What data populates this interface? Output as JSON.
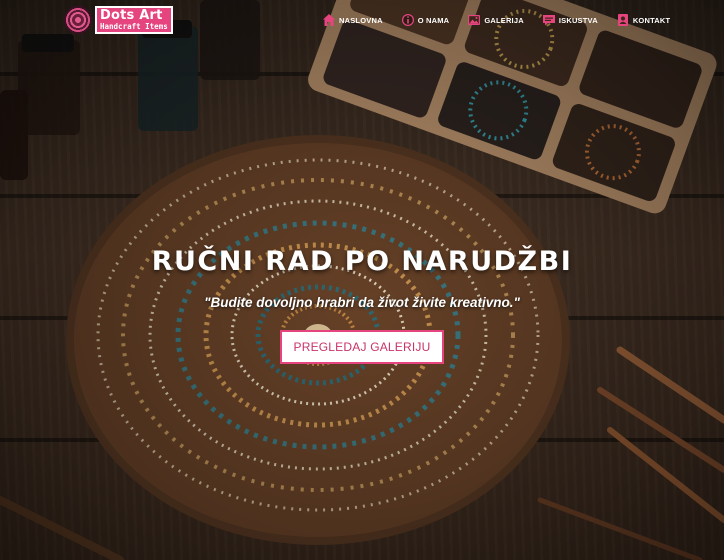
{
  "brand": {
    "name": "Dots Art",
    "tagline": "Handcraft Items",
    "accent": "#e6447e"
  },
  "nav": {
    "items": [
      {
        "label": "NASLOVNA",
        "icon": "home-icon"
      },
      {
        "label": "O NAMA",
        "icon": "info-icon"
      },
      {
        "label": "GALERIJA",
        "icon": "gallery-icon"
      },
      {
        "label": "ISKUSTVA",
        "icon": "chat-icon"
      },
      {
        "label": "KONTAKT",
        "icon": "contact-icon"
      }
    ]
  },
  "hero": {
    "title": "RUČNI RAD PO NARUDŽBI",
    "quote": "\"Budite dovoljno hrabri da život živite kreativno.\"",
    "button_label": "PREGLEDAJ GALERIJU",
    "background": "dot-mandala-on-wooden-table"
  }
}
